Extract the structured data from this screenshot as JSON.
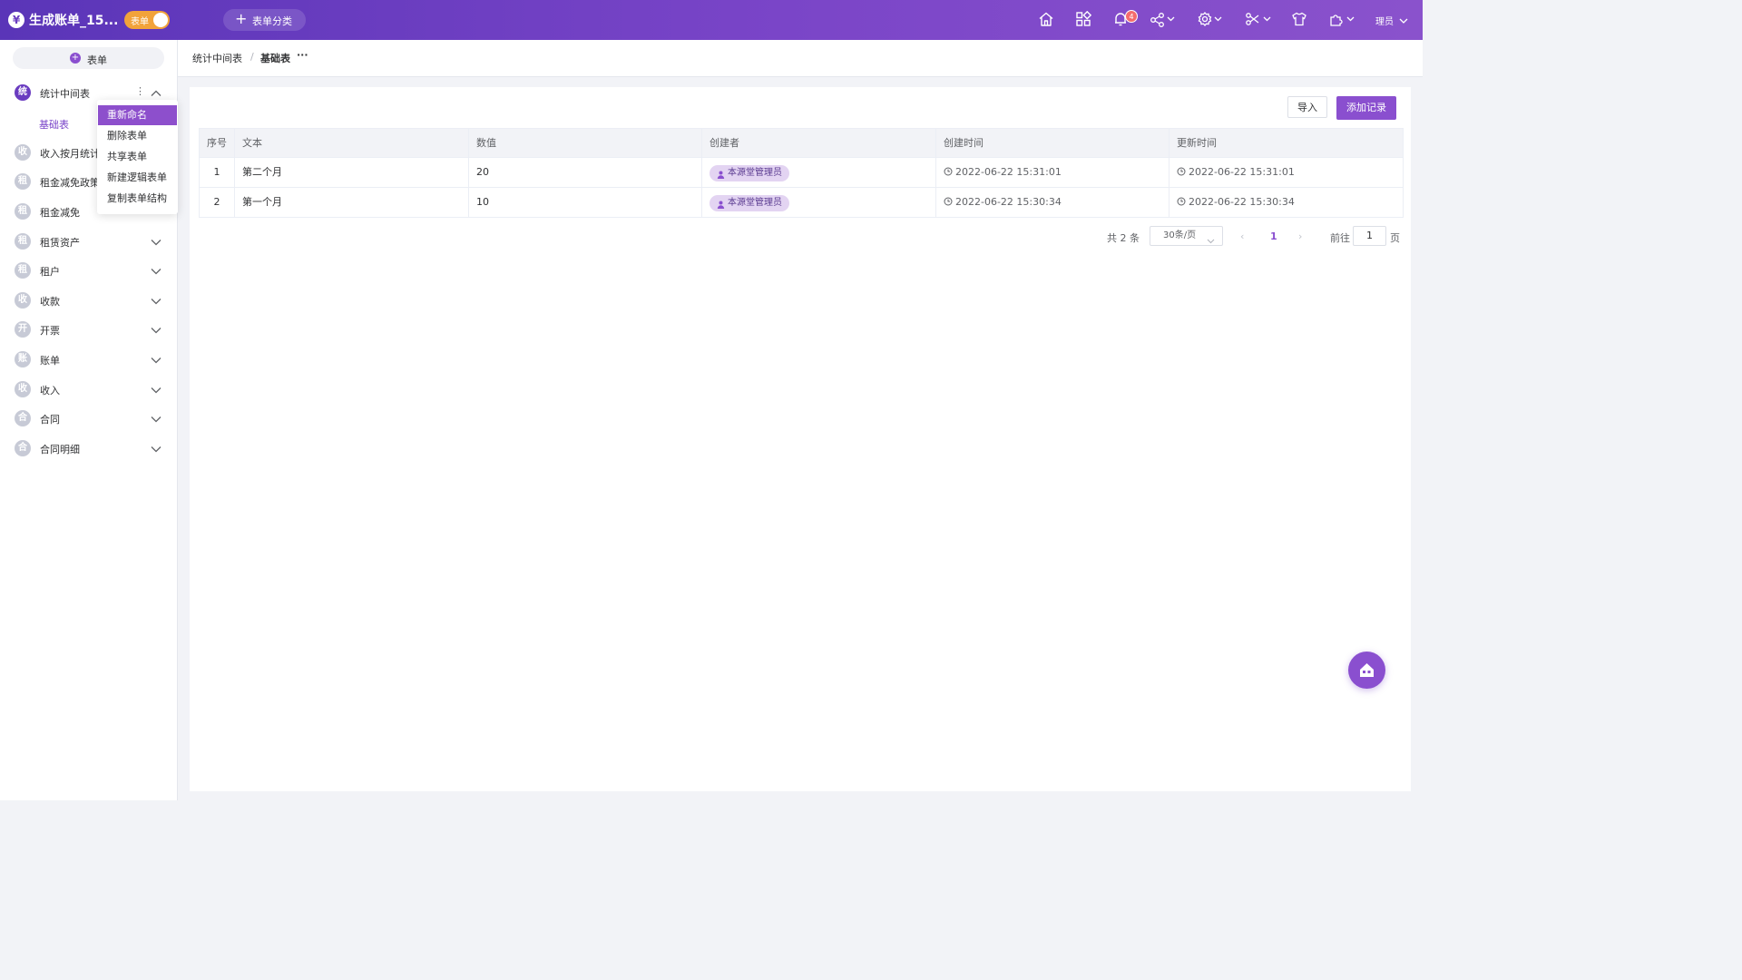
{
  "app": {
    "logo_glyph": "¥",
    "title": "生成账单_15...",
    "mode_label": "表单",
    "category_button": "表单分类",
    "notification_count": "4",
    "user_name": "理员"
  },
  "colors": {
    "primary": "#8a4fcf",
    "header_start": "#5a35b8",
    "header_end": "#8a52cc",
    "toggle": "#f2a33a",
    "badge": "#f56c6c"
  },
  "sidebar": {
    "new_form_label": "表单",
    "groups": [
      {
        "icon": "统",
        "label": "统计中间表",
        "expanded": true
      },
      {
        "icon": "收",
        "label": "收入按月统计"
      },
      {
        "icon": "租",
        "label": "租金减免政策"
      },
      {
        "icon": "租",
        "label": "租金减免"
      },
      {
        "icon": "租",
        "label": "租赁资产"
      },
      {
        "icon": "租",
        "label": "租户"
      },
      {
        "icon": "收",
        "label": "收款"
      },
      {
        "icon": "开",
        "label": "开票"
      },
      {
        "icon": "账",
        "label": "账单"
      },
      {
        "icon": "收",
        "label": "收入"
      },
      {
        "icon": "合",
        "label": "合同"
      },
      {
        "icon": "合",
        "label": "合同明细"
      }
    ],
    "active_sub_item": "基础表"
  },
  "context_menu": {
    "items": [
      "重新命名",
      "删除表单",
      "共享表单",
      "新建逻辑表单",
      "复制表单结构"
    ],
    "highlighted": "重新命名"
  },
  "breadcrumb": {
    "parent": "统计中间表",
    "separator": "/",
    "current": "基础表",
    "more": "···"
  },
  "toolbar": {
    "import_label": "导入",
    "add_label": "添加记录"
  },
  "table": {
    "columns": [
      "序号",
      "文本",
      "数值",
      "创建者",
      "创建时间",
      "更新时间"
    ],
    "rows": [
      {
        "index": "1",
        "text": "第二个月",
        "value": "20",
        "creator": "本源堂管理员",
        "created": "2022-06-22 15:31:01",
        "updated": "2022-06-22 15:31:01"
      },
      {
        "index": "2",
        "text": "第一个月",
        "value": "10",
        "creator": "本源堂管理员",
        "created": "2022-06-22 15:30:34",
        "updated": "2022-06-22 15:30:34"
      }
    ]
  },
  "pagination": {
    "total": "共 2 条",
    "page_size": "30条/页",
    "prev": "‹",
    "current_page": "1",
    "next": "›",
    "goto_label": "前往",
    "goto_value": "1",
    "unit": "页"
  }
}
